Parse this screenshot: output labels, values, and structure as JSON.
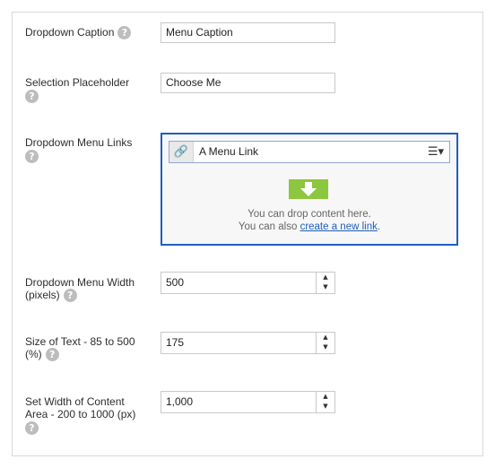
{
  "fields": {
    "dropdown_caption": {
      "label": "Dropdown Caption",
      "value": "Menu Caption"
    },
    "selection_placeholder": {
      "label": "Selection Placeholder",
      "value": "Choose Me"
    },
    "dropdown_menu_links": {
      "label": "Dropdown Menu Links",
      "link_item": "A Menu Link",
      "drop_line1": "You can drop content here.",
      "drop_line2_prefix": "You can also ",
      "drop_link": "create a new link",
      "drop_line2_suffix": "."
    },
    "dropdown_menu_width": {
      "label_line1": "Dropdown Menu Width",
      "label_line2": "(pixels)",
      "value": "500"
    },
    "size_of_text": {
      "label_line1": "Size of Text - 85 to 500",
      "label_line2": "(%)",
      "value": "175"
    },
    "content_area_width": {
      "label_line1": "Set Width of Content",
      "label_line2": "Area - 200 to 1000 (px)",
      "value": "1,000"
    }
  },
  "icons": {
    "help": "question-mark",
    "link": "chain-link",
    "menu": "hamburger-dropdown",
    "drop": "down-arrow"
  },
  "colors": {
    "accent_border": "#1f5fbf",
    "drop_arrow": "#8dc63f",
    "help_icon": "#bdbdbd"
  }
}
